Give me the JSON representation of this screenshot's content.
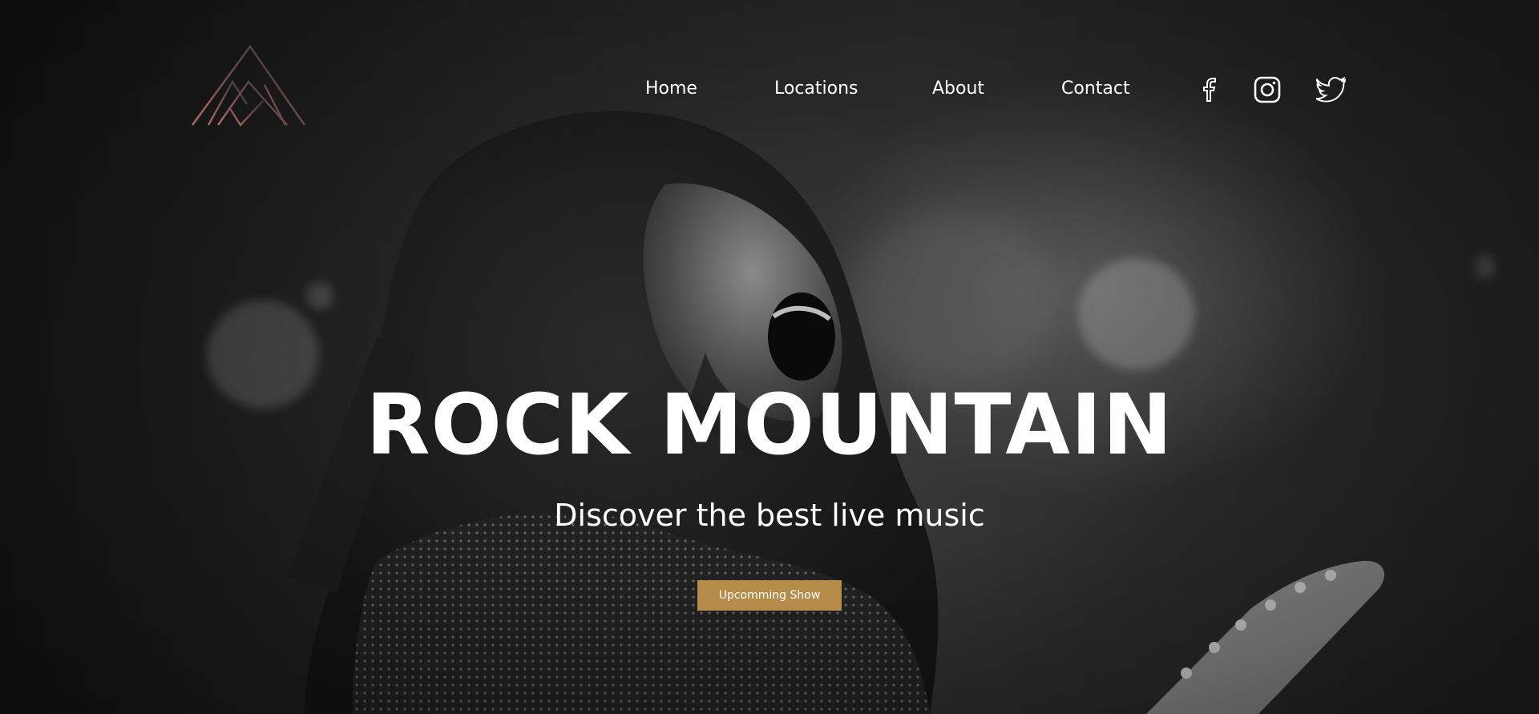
{
  "nav": {
    "items": [
      {
        "label": "Home"
      },
      {
        "label": "Locations"
      },
      {
        "label": "About"
      },
      {
        "label": "Contact"
      }
    ]
  },
  "social": {
    "facebook_icon": "facebook-icon",
    "instagram_icon": "instagram-icon",
    "twitter_icon": "twitter-icon"
  },
  "hero": {
    "title": "ROCK MOUNTAIN",
    "subtitle": "Discover the best live music",
    "cta_label": "Upcomming Show"
  },
  "colors": {
    "accent": "#b58c4a",
    "logo": "#8a5a5a",
    "text": "#ffffff"
  }
}
